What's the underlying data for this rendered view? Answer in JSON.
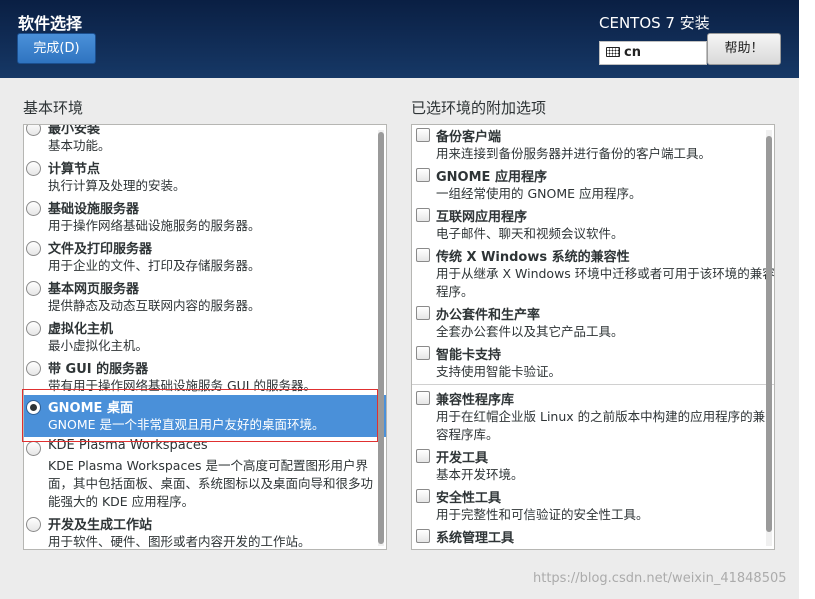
{
  "header": {
    "title": "软件选择",
    "done_label": "完成(D)",
    "install_title": "CENTOS 7 安装",
    "keyboard_layout": "cn",
    "help_label": "帮助！"
  },
  "base_environment": {
    "label": "基本环境",
    "items": [
      {
        "name": "最小安装",
        "desc": "基本功能。",
        "selected": false
      },
      {
        "name": "计算节点",
        "desc": "执行计算及处理的安装。",
        "selected": false
      },
      {
        "name": "基础设施服务器",
        "desc": "用于操作网络基础设施服务的服务器。",
        "selected": false
      },
      {
        "name": "文件及打印服务器",
        "desc": "用于企业的文件、打印及存储服务器。",
        "selected": false
      },
      {
        "name": "基本网页服务器",
        "desc": "提供静态及动态互联网内容的服务器。",
        "selected": false
      },
      {
        "name": "虚拟化主机",
        "desc": "最小虚拟化主机。",
        "selected": false
      },
      {
        "name": "带 GUI 的服务器",
        "desc": "带有用于操作网络基础设施服务 GUI 的服务器。",
        "selected": false
      },
      {
        "name": "GNOME 桌面",
        "desc": "GNOME 是一个非常直观且用户友好的桌面环境。",
        "selected": true
      },
      {
        "name": "KDE Plasma Workspaces",
        "desc": "KDE Plasma Workspaces 是一个高度可配置图形用户界面，其中包括面板、桌面、系统图标以及桌面向导和很多功能强大的 KDE 应用程序。",
        "selected": false
      },
      {
        "name": "开发及生成工作站",
        "desc": "用于软件、硬件、图形或者内容开发的工作站。",
        "selected": false
      }
    ]
  },
  "addons": {
    "label": "已选环境的附加选项",
    "items": [
      {
        "name": "备份客户端",
        "desc": "用来连接到备份服务器并进行备份的客户端工具。",
        "checked": false
      },
      {
        "name": "GNOME 应用程序",
        "desc": "一组经常使用的 GNOME 应用程序。",
        "checked": false
      },
      {
        "name": "互联网应用程序",
        "desc": "电子邮件、聊天和视频会议软件。",
        "checked": false
      },
      {
        "name": "传统 X Windows 系统的兼容性",
        "desc": "用于从继承 X Windows 环境中迁移或者可用于该环境的兼容程序。",
        "checked": false
      },
      {
        "name": "办公套件和生产率",
        "desc": "全套办公套件以及其它产品工具。",
        "checked": false
      },
      {
        "name": "智能卡支持",
        "desc": "支持使用智能卡验证。",
        "checked": false
      },
      {
        "name": "兼容性程序库",
        "desc": "用于在红帽企业版 Linux 的之前版本中构建的应用程序的兼容程序库。",
        "checked": false
      },
      {
        "name": "开发工具",
        "desc": "基本开发环境。",
        "checked": false
      },
      {
        "name": "安全性工具",
        "desc": "用于完整性和可信验证的安全性工具。",
        "checked": false
      },
      {
        "name": "系统管理工具",
        "desc": "",
        "checked": false
      }
    ]
  },
  "watermark": "https://blog.csdn.net/weixin_41848505"
}
